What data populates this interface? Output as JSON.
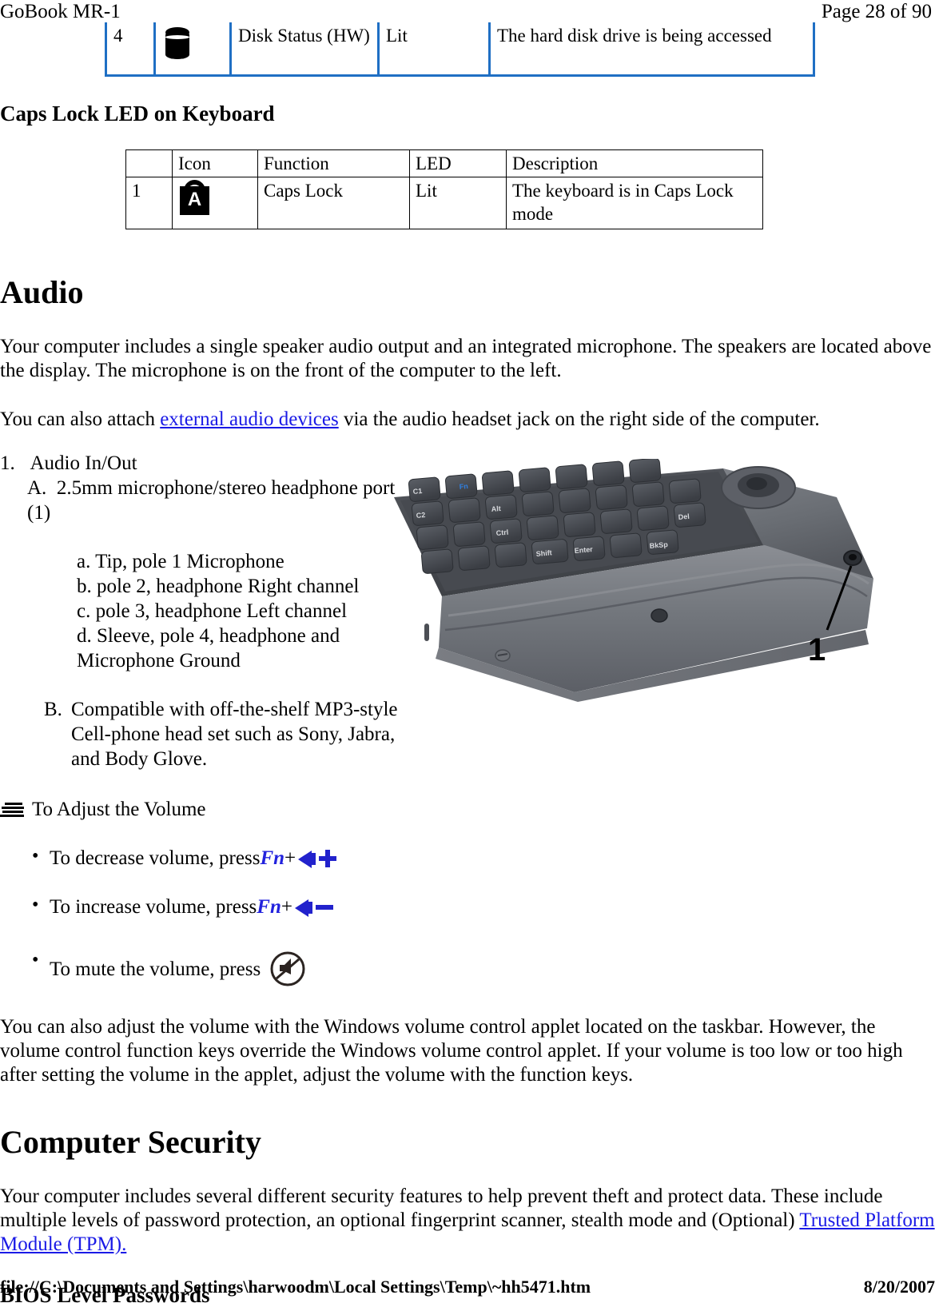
{
  "header": {
    "left": "GoBook MR-1",
    "right": "Page 28 of 90"
  },
  "footer": {
    "path": "file://C:\\Documents and Settings\\harwoodm\\Local Settings\\Temp\\~hh5471.htm",
    "date": "8/20/2007"
  },
  "disk_table": {
    "row": {
      "num": "4",
      "icon": "disk-drive-icon",
      "function": "Disk Status (HW)",
      "led": "Lit",
      "description": "The hard disk drive is being accessed"
    },
    "border_color": "#1f6fc4"
  },
  "capslock_section": {
    "heading": "Caps Lock LED on Keyboard",
    "table": {
      "headers": [
        "",
        "Icon",
        "Function",
        "LED",
        "Description"
      ],
      "rows": [
        {
          "num": "1",
          "icon": "caps-lock-padlock-icon",
          "function": "Caps Lock",
          "led": "Lit",
          "description": "The keyboard is in Caps Lock mode"
        }
      ]
    }
  },
  "audio_section": {
    "heading": "Audio",
    "paragraph1": "Your computer includes a single speaker  audio output and an integrated microphone. The speakers are located above the display. The microphone is on the front of the computer to the left.",
    "paragraph2_before": "You can also attach ",
    "paragraph2_link": "external audio devices",
    "paragraph2_after": " via the audio headset jack on the right side of the computer.",
    "list": {
      "item1": "1.",
      "item1_text": "Audio In/Out",
      "itemA": "A.",
      "itemA_text": "2.5mm microphone/stereo headphone port (1)",
      "subitems": [
        "a. Tip, pole 1 Microphone",
        "b. pole 2, headphone Right channel",
        "c.  pole 3, headphone Left channel",
        "d. Sleeve, pole 4, headphone and Microphone Ground"
      ],
      "itemB": "B.",
      "itemB_text": "Compatible with off-the-shelf MP3-style Cell-phone head set such as Sony, Jabra, and Body Glove."
    },
    "photo": {
      "alt": "rugged-laptop-keyboard-photo",
      "callout": "1",
      "key_labels": [
        "C1",
        "C2",
        "Alt",
        "Ctrl",
        "Shift",
        "Enter",
        "BkSp",
        "Del",
        "Fn"
      ]
    }
  },
  "volume_section": {
    "title": "To Adjust the Volume",
    "title_icon": "lines-icon",
    "bullets": [
      {
        "text_before": "To decrease volume, press ",
        "fn": "Fn",
        "plus": "+",
        "icon": "speaker-plus-icon",
        "sign": "plus"
      },
      {
        "text_before": "To increase volume, press ",
        "fn": "Fn",
        "plus": "+",
        "icon": "speaker-minus-icon",
        "sign": "minus"
      },
      {
        "text_before": "To mute the volume, press ",
        "fn": "",
        "plus": "",
        "icon": "speaker-mute-icon",
        "sign": "mute"
      }
    ],
    "paragraph": "You can also adjust the volume with the Windows volume control applet located on the taskbar.  However, the volume control function keys override the Windows volume control applet.  If your volume is too low or too high after setting the volume in the applet, adjust the volume with the function keys."
  },
  "security_section": {
    "heading": "Computer Security",
    "paragraph_before": "Your computer includes several different security features to help prevent theft and protect data. These include multiple levels of password protection, an optional fingerprint scanner,  stealth mode and (Optional) ",
    "paragraph_link": "Trusted Platform Module (TPM).",
    "subheading": "BIOS Level Passwords"
  },
  "colors": {
    "link": "#1a1ae6",
    "fn_key": "#2222dd",
    "table_blue": "#1f6fc4"
  }
}
